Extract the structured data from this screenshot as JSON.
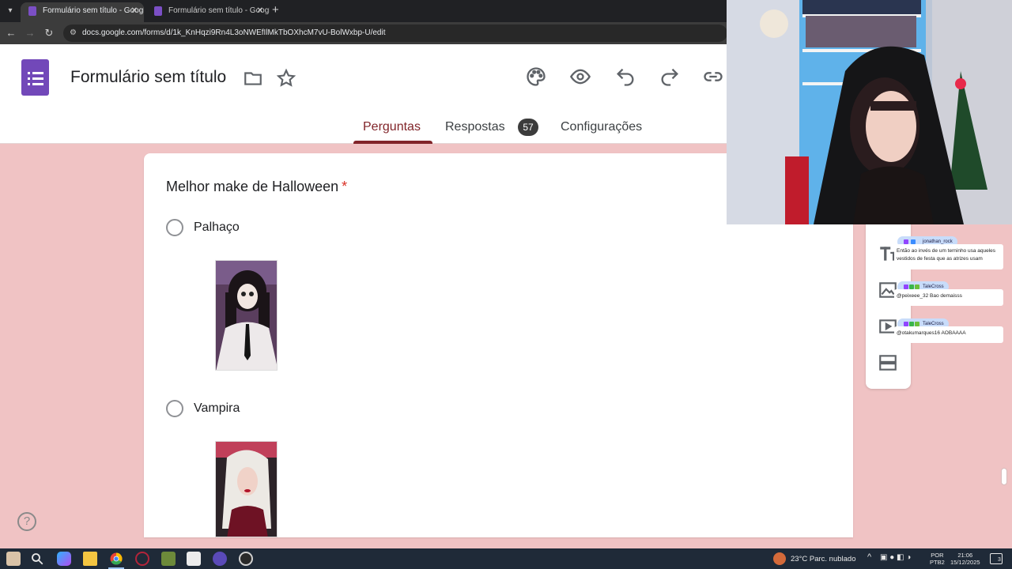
{
  "browser": {
    "tabs": [
      {
        "title": "Formulário sem título - Google",
        "active": true
      },
      {
        "title": "Formulário sem título - Google",
        "active": false
      }
    ],
    "url": "docs.google.com/forms/d/1k_KnHqzi9Rn4L3oNWEfIlMkTbOXhcM7vU-BolWxbp-U/edit",
    "new_tab": "+"
  },
  "forms": {
    "title": "Formulário sem título",
    "tabs": {
      "questions": "Perguntas",
      "responses": "Respostas",
      "responses_count": "57",
      "settings": "Configurações"
    }
  },
  "question": {
    "title": "Melhor make de Halloween",
    "required_mark": "*",
    "options": [
      {
        "label": "Palhaço"
      },
      {
        "label": "Vampira"
      }
    ]
  },
  "chat": [
    {
      "user": "jonathan_rock",
      "text": "Então ao invés de um terninho usa aqueles vestidos de festa que as atrizes usam"
    },
    {
      "user": "TaleCross",
      "text": "@peixeee_32 Bao demaisss"
    },
    {
      "user": "TaleCross",
      "text": "@otakumarques16 AOBAAAA"
    }
  ],
  "taskbar": {
    "weather": "23°C  Parc. nublado",
    "lang_line1": "POR",
    "lang_line2": "PTB2",
    "time": "21:06",
    "date": "15/12/2025",
    "notifications": "3"
  },
  "colors": {
    "background": "#f0c3c4",
    "accent": "#812429",
    "forms_purple": "#7248b9"
  }
}
